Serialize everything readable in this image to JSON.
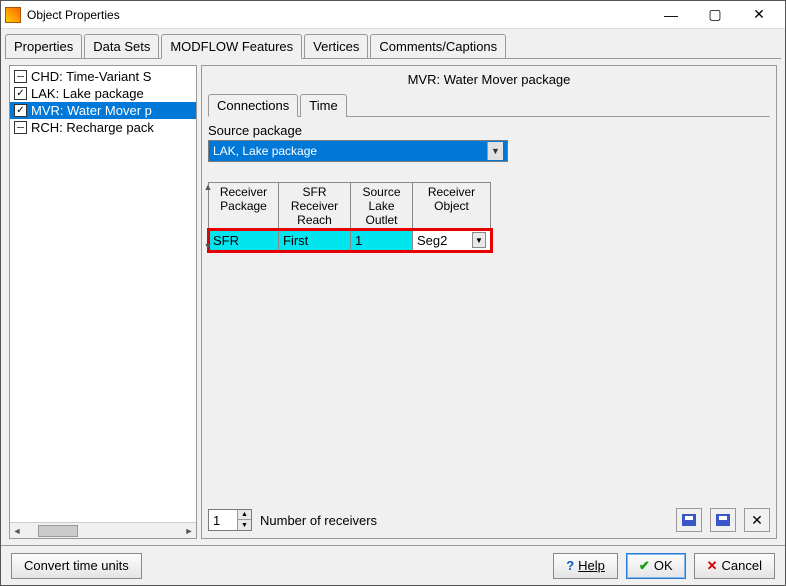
{
  "window": {
    "title": "Object Properties"
  },
  "tabs": {
    "properties": "Properties",
    "datasets": "Data Sets",
    "modflow": "MODFLOW Features",
    "vertices": "Vertices",
    "comments": "Comments/Captions"
  },
  "tree": {
    "chd": "CHD: Time-Variant S",
    "lak": "LAK: Lake package",
    "mvr": "MVR: Water Mover p",
    "rch": "RCH: Recharge pack"
  },
  "panel": {
    "title": "MVR: Water Mover package",
    "subtabs": {
      "connections": "Connections",
      "time": "Time"
    },
    "source_label": "Source package",
    "source_value": "LAK, Lake package"
  },
  "grid": {
    "headers": {
      "receiver_package": "Receiver Package",
      "sfr_receiver_reach": "SFR Receiver Reach",
      "source_lake_outlet": "Source Lake Outlet",
      "receiver_object": "Receiver Object"
    },
    "row": {
      "receiver_package": "SFR",
      "sfr_receiver_reach": "First",
      "source_lake_outlet": "1",
      "receiver_object": "Seg2"
    }
  },
  "toolbar": {
    "count": "1",
    "count_label": "Number of receivers"
  },
  "footer": {
    "convert": "Convert time units",
    "help": "Help",
    "ok": "OK",
    "cancel": "Cancel"
  }
}
